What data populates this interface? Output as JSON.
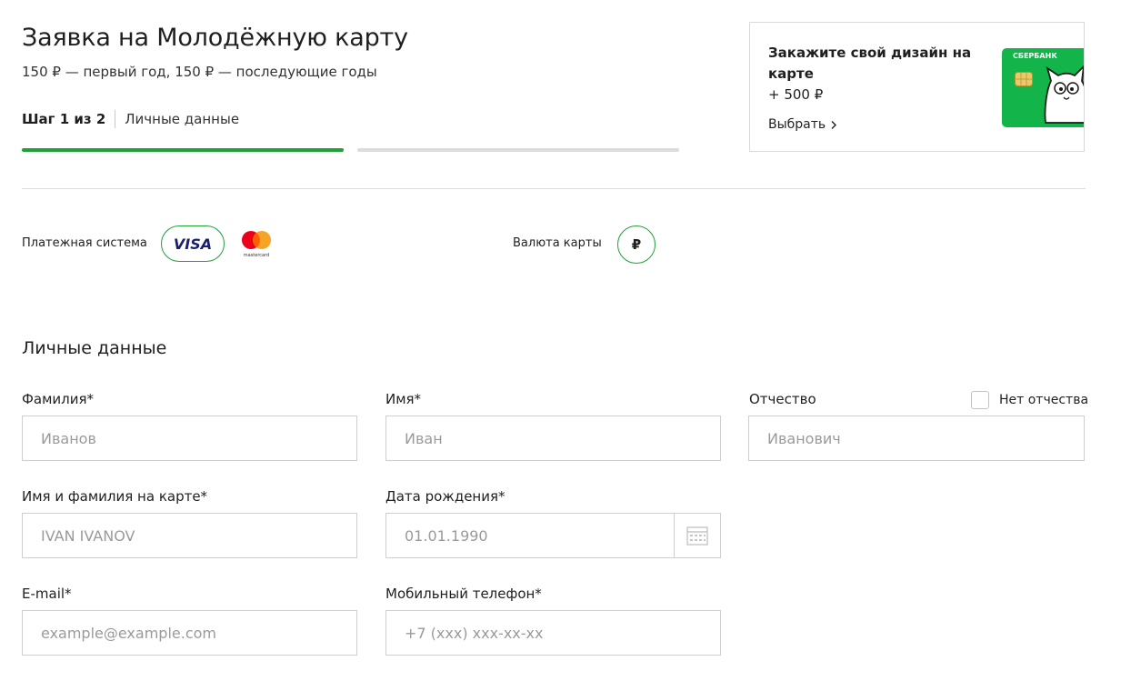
{
  "colors": {
    "accent": "#21a038",
    "progress_inactive": "#dcdcdc",
    "card_green": "#13b54a",
    "visa_blue": "#1a1f71",
    "mc_red": "#eb001b",
    "mc_yellow": "#f79e1b"
  },
  "header": {
    "title": "Заявка на Молодёжную карту",
    "subtitle": "150 ₽ — первый год, 150 ₽ — последующие годы",
    "step_counter": "Шаг 1 из 2",
    "step_name": "Личные данные"
  },
  "progress": {
    "total_steps": 2,
    "current_step": 1
  },
  "promo": {
    "title": "Закажите свой дизайн на карте",
    "price": "+ 500 ₽",
    "link": "Выбрать",
    "card_bank_name": "СБЕРБАНК",
    "icons": [
      "chevron-right-icon",
      "card-design-image"
    ]
  },
  "payment": {
    "label": "Платежная система",
    "options": [
      "VISA",
      "mastercard"
    ],
    "selected": "VISA"
  },
  "currency": {
    "label": "Валюта карты",
    "selected": "₽"
  },
  "personal": {
    "section_title": "Личные данные",
    "fields": {
      "last_name": {
        "label": "Фамилия*",
        "placeholder": "Иванов"
      },
      "first_name": {
        "label": "Имя*",
        "placeholder": "Иван"
      },
      "patronymic": {
        "label": "Отчество",
        "placeholder": "Иванович",
        "no_patronymic_label": "Нет отчества",
        "no_patronymic_checked": false
      },
      "card_name": {
        "label": "Имя и фамилия на карте*",
        "placeholder": "IVAN IVANOV"
      },
      "birth_date": {
        "label": "Дата рождения*",
        "placeholder": "01.01.1990",
        "icon": "calendar-icon"
      },
      "email": {
        "label": "E-mail*",
        "placeholder": "example@example.com"
      },
      "phone": {
        "label": "Мобильный телефон*",
        "placeholder": "+7 (xxx) xxx-xx-xx"
      }
    }
  }
}
